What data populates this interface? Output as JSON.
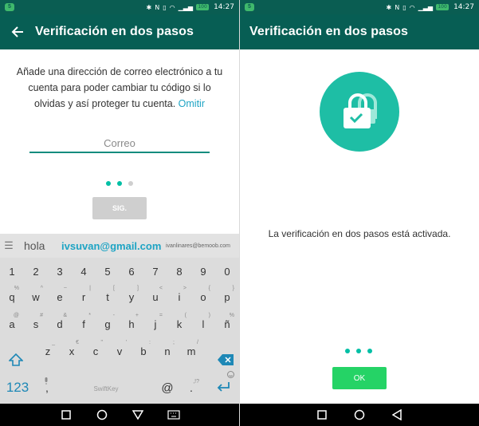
{
  "colors": {
    "status_bar": "#0a5d52",
    "app_bar": "#075e54",
    "accent": "#00bfa5",
    "ok_button": "#25d366",
    "link": "#1ea4c4"
  },
  "status_bar": {
    "sim": "5",
    "time": "14:27",
    "battery": "100"
  },
  "left": {
    "title": "Verificación en dos pasos",
    "description": "Añade una dirección de correo electrónico a tu cuenta para poder cambiar tu código si lo olvidas y así proteger tu cuenta.",
    "skip_link": "Omitir",
    "email_placeholder": "Correo",
    "next_button": "SIG.",
    "steps_total": 3,
    "step_current": 2
  },
  "keyboard": {
    "suggestions": [
      "hola",
      "ivsuvan@gmail.com",
      "ivanlinares@bemoob.com"
    ],
    "row_numbers": [
      "1",
      "2",
      "3",
      "4",
      "5",
      "6",
      "7",
      "8",
      "9",
      "0"
    ],
    "row1": [
      {
        "k": "q",
        "alt": "%"
      },
      {
        "k": "w",
        "alt": "^"
      },
      {
        "k": "e",
        "alt": "~"
      },
      {
        "k": "r",
        "alt": "|"
      },
      {
        "k": "t",
        "alt": "["
      },
      {
        "k": "y",
        "alt": "]"
      },
      {
        "k": "u",
        "alt": "<"
      },
      {
        "k": "i",
        "alt": ">"
      },
      {
        "k": "o",
        "alt": "{"
      },
      {
        "k": "p",
        "alt": "}"
      }
    ],
    "row2": [
      {
        "k": "a",
        "alt": "@"
      },
      {
        "k": "s",
        "alt": "#"
      },
      {
        "k": "d",
        "alt": "&"
      },
      {
        "k": "f",
        "alt": "*"
      },
      {
        "k": "g",
        "alt": "-"
      },
      {
        "k": "h",
        "alt": "+"
      },
      {
        "k": "j",
        "alt": "="
      },
      {
        "k": "k",
        "alt": "("
      },
      {
        "k": "l",
        "alt": ")"
      },
      {
        "k": "ñ",
        "alt": "%"
      }
    ],
    "row3": [
      {
        "k": "z",
        "alt": "_"
      },
      {
        "k": "x",
        "alt": "€"
      },
      {
        "k": "c",
        "alt": "\""
      },
      {
        "k": "v",
        "alt": "'"
      },
      {
        "k": "b",
        "alt": ":"
      },
      {
        "k": "n",
        "alt": ";"
      },
      {
        "k": "m",
        "alt": "/"
      }
    ],
    "numeric_key": "123",
    "comma_key": ",",
    "space_brand": "SwiftKey",
    "at_key": "@",
    "dot_key": ".",
    "dot_alt": ",!?",
    "icons": {
      "menu": "menu-icon",
      "shift": "shift-icon",
      "backspace": "backspace-icon",
      "mic": "mic-icon",
      "enter": "enter-icon",
      "emoji": "emoji-icon"
    }
  },
  "right": {
    "title": "Verificación en dos pasos",
    "message": "La verificación en dos pasos está activada.",
    "ok_button": "OK",
    "steps_total": 3,
    "step_current": 3,
    "icons": {
      "lock": "lock-check-icon"
    }
  },
  "nav": {
    "icons": [
      "square-icon",
      "circle-icon",
      "triangle-icon",
      "keyboard-icon"
    ]
  }
}
